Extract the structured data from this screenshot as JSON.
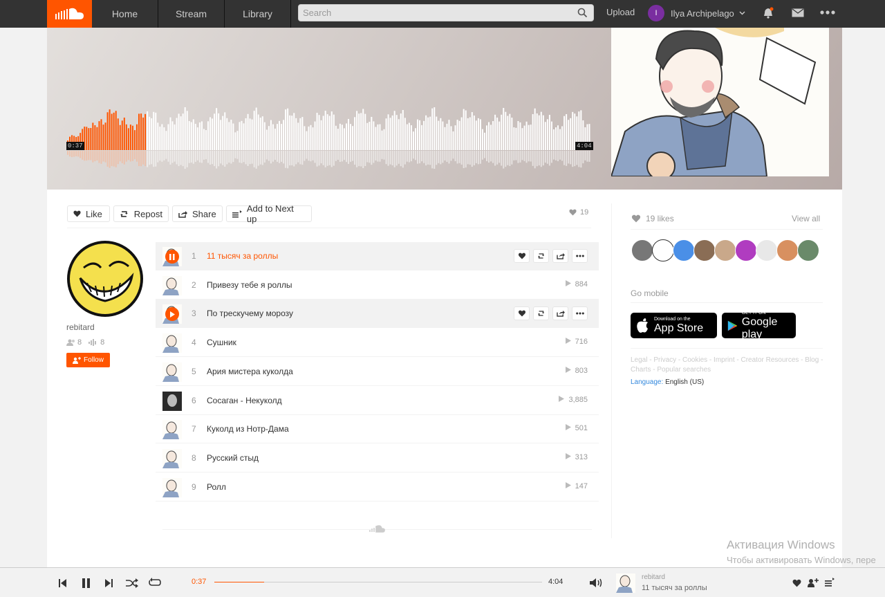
{
  "nav": {
    "home": "Home",
    "stream": "Stream",
    "library": "Library",
    "search_placeholder": "Search",
    "upload": "Upload",
    "user_initial": "I",
    "user_name": "Ilya Archipelago"
  },
  "waveform": {
    "current_time": "0:37",
    "duration": "4:04",
    "progress_fraction": 0.152
  },
  "actions": {
    "like": "Like",
    "repost": "Repost",
    "share": "Share",
    "next_up": "Add to Next up",
    "like_count": "19"
  },
  "uploader": {
    "name": "rebitard",
    "followers": "8",
    "tracks": "8",
    "follow": "Follow"
  },
  "tracks": [
    {
      "num": "1",
      "title": "11 тысяч за роллы",
      "plays": "",
      "state": "playing"
    },
    {
      "num": "2",
      "title": "Привезу тебе я роллы",
      "plays": "884",
      "state": ""
    },
    {
      "num": "3",
      "title": "По трескучему морозу",
      "plays": "",
      "state": "hover"
    },
    {
      "num": "4",
      "title": "Сушник",
      "plays": "716",
      "state": ""
    },
    {
      "num": "5",
      "title": "Ария мистера куколда",
      "plays": "803",
      "state": ""
    },
    {
      "num": "6",
      "title": "Сосаган - Некуколд",
      "plays": "3,885",
      "state": ""
    },
    {
      "num": "7",
      "title": "Куколд из Нотр-Дама",
      "plays": "501",
      "state": ""
    },
    {
      "num": "8",
      "title": "Русский стыд",
      "plays": "313",
      "state": ""
    },
    {
      "num": "9",
      "title": "Ролл",
      "plays": "147",
      "state": ""
    }
  ],
  "sidebar": {
    "likes": "19 likes",
    "view_all": "View all",
    "go_mobile": "Go mobile",
    "appstore_small": "Download on the",
    "appstore_big": "App Store",
    "gplay_small": "GET IT ON",
    "gplay_big": "Google play",
    "links": "Legal - Privacy - Cookies - Imprint - Creator Resources - Blog - Charts - Popular searches",
    "language_label": "Language:",
    "language_value": "English (US)"
  },
  "windows": {
    "line1": "Активация Windows",
    "line2": "Чтобы активировать Windows, пере"
  },
  "player": {
    "current": "0:37",
    "duration": "4:04",
    "user": "rebitard",
    "title": "11 тысяч за роллы"
  },
  "colors": {
    "accent": "#ff5500",
    "nav_bg": "#333333"
  }
}
